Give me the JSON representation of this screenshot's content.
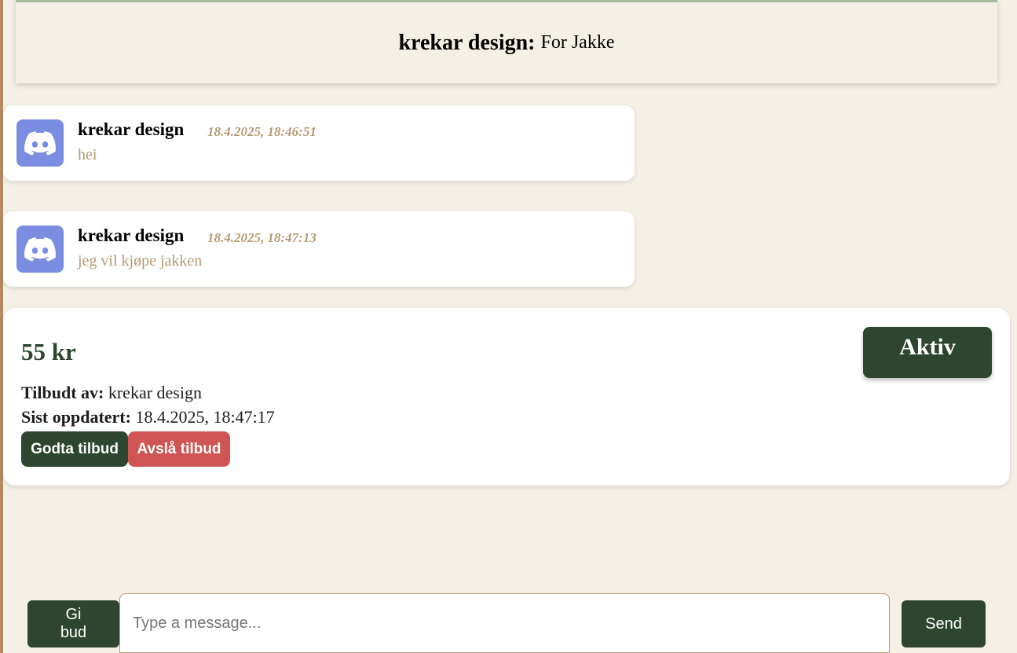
{
  "header": {
    "seller": "krekar design:",
    "product": "For Jakke"
  },
  "messages": [
    {
      "author": "krekar design",
      "timestamp": "18.4.2025, 18:46:51",
      "text": "hei",
      "avatar_icon": "discord-icon"
    },
    {
      "author": "krekar design",
      "timestamp": "18.4.2025, 18:47:13",
      "text": "jeg vil kjøpe jakken",
      "avatar_icon": "discord-icon"
    }
  ],
  "offer": {
    "price": "55 kr",
    "status": "Aktiv",
    "offered_by_label": "Tilbudt av:",
    "offered_by": "krekar design",
    "updated_label": "Sist oppdatert:",
    "updated": "18.4.2025, 18:47:17",
    "accept_label": "Godta tilbud",
    "reject_label": "Avslå tilbud"
  },
  "composer": {
    "bid_label": "Gi bud",
    "placeholder": "Type a message...",
    "send_label": "Send"
  },
  "colors": {
    "background": "#f4f0e6",
    "primary_green": "#2e4630",
    "reject_red": "#cf5555",
    "meta_tan": "#b59a74",
    "discord_blurple": "#7b8de0"
  }
}
